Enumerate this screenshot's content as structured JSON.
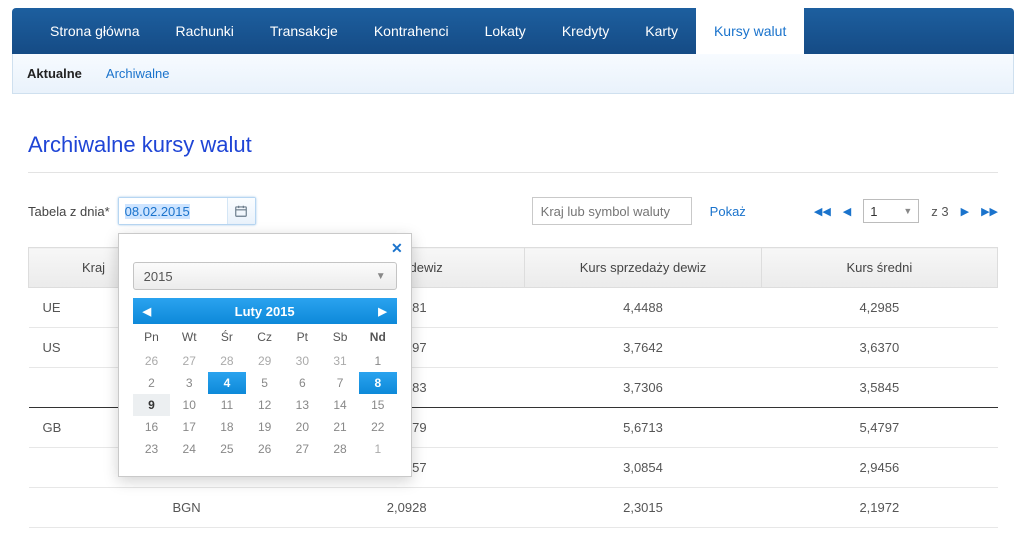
{
  "topnav": {
    "items": [
      {
        "label": "Strona główna"
      },
      {
        "label": "Rachunki"
      },
      {
        "label": "Transakcje"
      },
      {
        "label": "Kontrahenci"
      },
      {
        "label": "Lokaty"
      },
      {
        "label": "Kredyty"
      },
      {
        "label": "Karty"
      },
      {
        "label": "Kursy walut",
        "active": true
      }
    ]
  },
  "subnav": {
    "items": [
      {
        "label": "Aktualne",
        "active": true
      },
      {
        "label": "Archiwalne"
      }
    ]
  },
  "page": {
    "title": "Archiwalne kursy walut"
  },
  "toolbar": {
    "date_label": "Tabela z dnia*",
    "date_value": "08.02.2015",
    "filter_placeholder": "Kraj lub symbol waluty",
    "show_label": "Pokaż"
  },
  "pager": {
    "page": "1",
    "of_label": "z",
    "total": "3"
  },
  "table": {
    "headers": [
      "Kraj",
      "",
      "kupna dewiz",
      "Kurs sprzedaży dewiz",
      "Kurs średni"
    ],
    "rows": [
      {
        "kraj": "UE",
        "sym": "",
        "k": "4,1481",
        "s": "4,4488",
        "m": "4,2985",
        "sep": false
      },
      {
        "kraj": "US",
        "sym": "",
        "k": "3,5097",
        "s": "3,7642",
        "m": "3,6370",
        "sep": false
      },
      {
        "kraj": "",
        "sym": "",
        "k": "3,4383",
        "s": "3,7306",
        "m": "3,5845",
        "sep": true
      },
      {
        "kraj": "GB",
        "sym": "",
        "k": "5,2879",
        "s": "5,6713",
        "m": "5,4797",
        "sep": false
      },
      {
        "kraj": "",
        "sym": "",
        "k": "2,8057",
        "s": "3,0854",
        "m": "2,9456",
        "sep": false
      },
      {
        "kraj": "",
        "sym": "BGN",
        "k": "2,0928",
        "s": "2,3015",
        "m": "2,1972",
        "sep": false
      }
    ]
  },
  "datepicker": {
    "year": "2015",
    "month_label": "Luty 2015",
    "dow": [
      "Pn",
      "Wt",
      "Śr",
      "Cz",
      "Pt",
      "Sb",
      "Nd"
    ],
    "weeks": [
      [
        {
          "n": "26"
        },
        {
          "n": "27"
        },
        {
          "n": "28"
        },
        {
          "n": "29"
        },
        {
          "n": "30"
        },
        {
          "n": "31"
        },
        {
          "n": "1",
          "in": true
        }
      ],
      [
        {
          "n": "2",
          "in": true
        },
        {
          "n": "3",
          "in": true
        },
        {
          "n": "4",
          "in": true,
          "sel": true
        },
        {
          "n": "5",
          "in": true
        },
        {
          "n": "6",
          "in": true
        },
        {
          "n": "7",
          "in": true
        },
        {
          "n": "8",
          "in": true,
          "sel": true
        }
      ],
      [
        {
          "n": "9",
          "in": true,
          "today": true
        },
        {
          "n": "10",
          "in": true
        },
        {
          "n": "11",
          "in": true
        },
        {
          "n": "12",
          "in": true
        },
        {
          "n": "13",
          "in": true
        },
        {
          "n": "14",
          "in": true
        },
        {
          "n": "15",
          "in": true
        }
      ],
      [
        {
          "n": "16",
          "in": true
        },
        {
          "n": "17",
          "in": true
        },
        {
          "n": "18",
          "in": true
        },
        {
          "n": "19",
          "in": true
        },
        {
          "n": "20",
          "in": true
        },
        {
          "n": "21",
          "in": true
        },
        {
          "n": "22",
          "in": true
        }
      ],
      [
        {
          "n": "23",
          "in": true
        },
        {
          "n": "24",
          "in": true
        },
        {
          "n": "25",
          "in": true
        },
        {
          "n": "26",
          "in": true
        },
        {
          "n": "27",
          "in": true
        },
        {
          "n": "28",
          "in": true
        },
        {
          "n": "1"
        }
      ]
    ]
  }
}
